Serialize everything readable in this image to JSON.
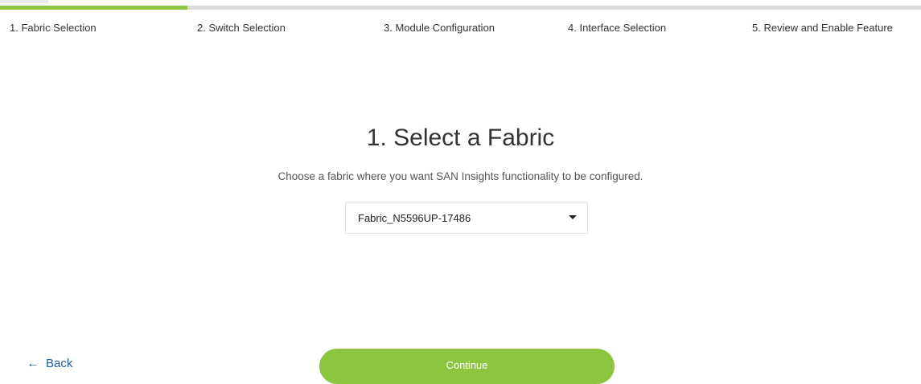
{
  "stepper": {
    "steps": [
      {
        "label": "1. Fabric Selection",
        "active": true
      },
      {
        "label": "2. Switch Selection",
        "active": false
      },
      {
        "label": "3. Module Configuration",
        "active": false
      },
      {
        "label": "4. Interface Selection",
        "active": false
      },
      {
        "label": "5. Review and Enable Feature",
        "active": false
      }
    ]
  },
  "main": {
    "title": "1. Select a Fabric",
    "subtitle": "Choose a fabric where you want SAN Insights functionality to be configured.",
    "fabric_select": {
      "value": "Fabric_N5596UP-17486"
    }
  },
  "footer": {
    "back_label": "Back",
    "back_icon": "arrow-left-icon",
    "continue_label": "Continue"
  },
  "colors": {
    "accent": "#8cc63f",
    "link": "#1f5d9a",
    "inactive_bar": "#d9d9d9"
  }
}
